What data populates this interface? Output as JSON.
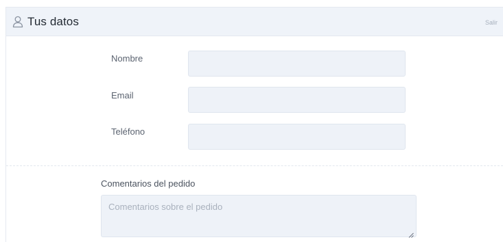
{
  "header": {
    "title": "Tus datos",
    "logout_label": "Salir",
    "icon": "user-icon"
  },
  "form": {
    "fields": [
      {
        "label": "Nombre",
        "value": ""
      },
      {
        "label": "Email",
        "value": ""
      },
      {
        "label": "Teléfono",
        "value": ""
      }
    ],
    "comments": {
      "label": "Comentarios del pedido",
      "placeholder": "Comentarios sobre el pedido"
    }
  },
  "colors": {
    "header_bg": "#eff3f9",
    "input_bg": "#eef2f8",
    "input_border": "#dfe5ee"
  }
}
